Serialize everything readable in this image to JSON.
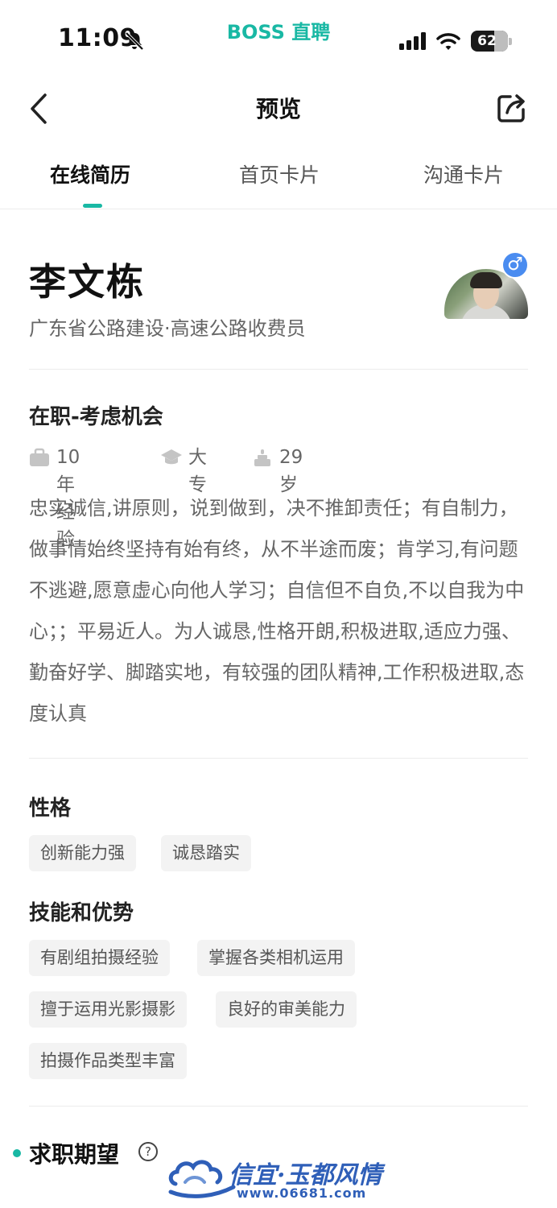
{
  "status_bar": {
    "time": "11:09",
    "app_brand": "BOSS 直聘",
    "battery_level": "62",
    "battery_fraction": 0.62
  },
  "nav": {
    "title": "预览"
  },
  "tabs": [
    {
      "label": "在线简历",
      "active": true
    },
    {
      "label": "首页卡片",
      "active": false
    },
    {
      "label": "沟通卡片",
      "active": false
    }
  ],
  "profile": {
    "name": "李文栋",
    "subtitle": "广东省公路建设·高速公路收费员",
    "gender_symbol": "♂"
  },
  "job_status": {
    "title": "在职-考虑机会",
    "experience": "10年经验",
    "education": "大专",
    "age": "29岁",
    "bio": "忠实诚信,讲原则，说到做到，决不推卸责任；有自制力，做事情始终坚持有始有终，从不半途而废；肯学习,有问题不逃避,愿意虚心向他人学习；自信但不自负,不以自我为中心；；平易近人。为人诚恳,性格开朗,积极进取,适应力强、勤奋好学、脚踏实地，有较强的团队精神,工作积极进取,态度认真"
  },
  "personality": {
    "title": "性格",
    "tags": [
      "创新能力强",
      "诚恳踏实"
    ]
  },
  "skills": {
    "title": "技能和优势",
    "tags": [
      "有剧组拍摄经验",
      "掌握各类相机运用",
      "擅于运用光影摄影",
      "良好的审美能力",
      "拍摄作品类型丰富"
    ]
  },
  "expectation": {
    "title": "求职期望",
    "help_symbol": "?"
  },
  "watermark": {
    "title": "信宜·玉都风情",
    "url": "www.06681.com"
  },
  "colors": {
    "accent": "#19b8a4",
    "gender_badge": "#4a8cf0",
    "watermark": "#2f5fb8"
  },
  "icons": [
    "bell-off-icon",
    "signal-icon",
    "wifi-icon",
    "battery-icon",
    "back-arrow-icon",
    "share-icon",
    "briefcase-icon",
    "graduation-cap-icon",
    "birthday-cake-icon",
    "male-icon",
    "help-icon"
  ]
}
